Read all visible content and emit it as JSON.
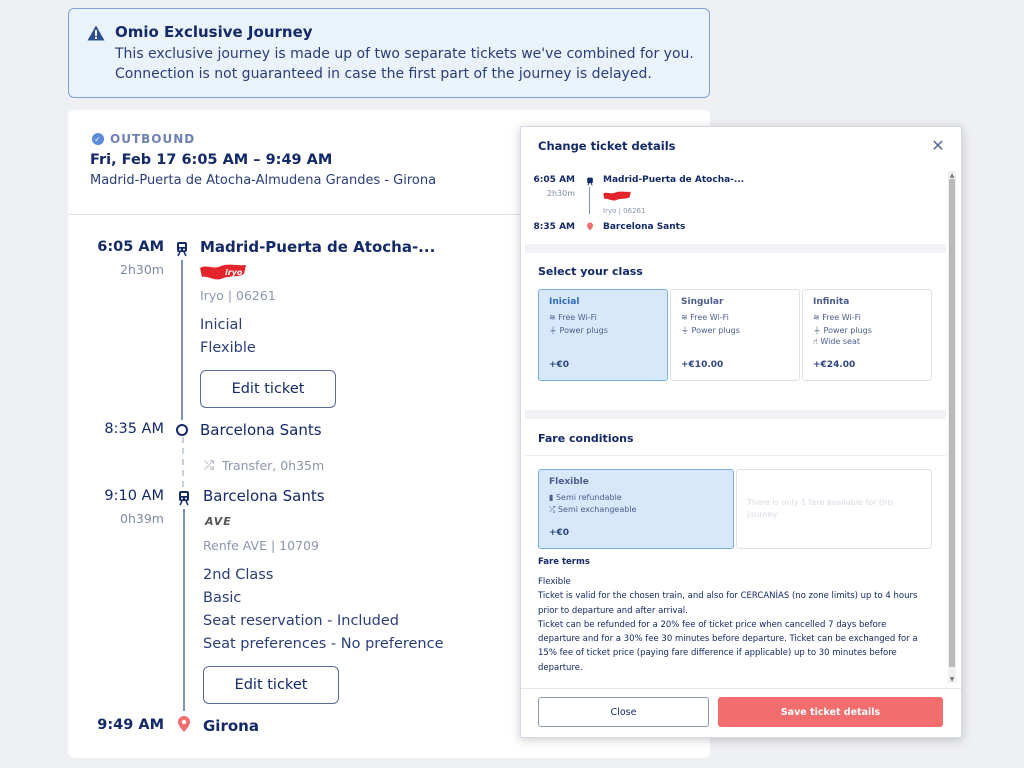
{
  "banner": {
    "title": "Omio Exclusive Journey",
    "line1": "This exclusive journey is made up of two separate tickets we've combined for you.",
    "line2": "Connection is not guaranteed in case the first part of the journey is delayed.",
    "icon": "warning-icon"
  },
  "outbound": {
    "label": "OUTBOUND",
    "when": "Fri, Feb 17  6:05 AM – 9:49 AM",
    "route": "Madrid-Puerta de Atocha-Almudena Grandes - Girona"
  },
  "legs": [
    {
      "dep_time": "6:05 AM",
      "duration": "2h30m",
      "dep_station": "Madrid-Puerta de Atocha-...",
      "operator": "Iryo | 06261",
      "details": [
        "Inicial",
        "Flexible"
      ],
      "edit": "Edit ticket",
      "arr_time": "8:35 AM",
      "arr_station": "Barcelona Sants",
      "logo": "iryo"
    },
    {
      "dep_time": "9:10 AM",
      "duration": "0h39m",
      "dep_station": "Barcelona Sants",
      "operator": "Renfe AVE | 10709",
      "details": [
        "2nd Class",
        "Basic",
        "Seat reservation - Included",
        "Seat preferences - No preference"
      ],
      "edit": "Edit ticket",
      "arr_time": "9:49 AM",
      "arr_station": "Girona",
      "logo": "AVE"
    }
  ],
  "transfer": "Transfer, 0h35m",
  "modal": {
    "title": "Change ticket details",
    "summary": {
      "dep_time": "6:05 AM",
      "duration": "2h30m",
      "dep_station": "Madrid-Puerta de Atocha-...",
      "operator": "Iryo | 06261",
      "arr_time": "8:35 AM",
      "arr_station": "Barcelona Sants"
    },
    "class_heading": "Select your class",
    "classes": [
      {
        "name": "Inicial",
        "features": [
          "Free Wi-Fi",
          "Power plugs"
        ],
        "price": "+€0",
        "selected": true
      },
      {
        "name": "Singular",
        "features": [
          "Free Wi-Fi",
          "Power plugs"
        ],
        "price": "+€10.00",
        "selected": false
      },
      {
        "name": "Infinita",
        "features": [
          "Free Wi-Fi",
          "Power plugs",
          "Wide seat"
        ],
        "price": "+€24.00",
        "selected": false
      }
    ],
    "fare_heading": "Fare conditions",
    "fare": {
      "name": "Flexible",
      "features": [
        "Semi refundable",
        "Semi exchangeable"
      ],
      "price": "+€0",
      "only_one": "There is only 1 fare available for this journey"
    },
    "terms_heading": "Fare terms",
    "terms_lines": [
      "Flexible",
      "Ticket is valid for the chosen train, and also for CERCANÍAS (no zone limits) up to 4 hours",
      "prior to departure and after arrival.",
      "Ticket can be refunded for a 20% fee of ticket price when cancelled 7 days before",
      "departure and for a 30% fee 30 minutes before departure. Ticket can be exchanged for a",
      "15% fee of ticket price (paying fare difference if applicable) up to 30 minutes before",
      "departure."
    ],
    "close_label": "Close",
    "save_label": "Save ticket details"
  },
  "colors": {
    "navy": "#132968",
    "accent_red": "#f26e6e",
    "selected_bg": "#d7e8fb",
    "banner_bg": "#eaf3fc",
    "iryo_red": "#e3242b"
  }
}
